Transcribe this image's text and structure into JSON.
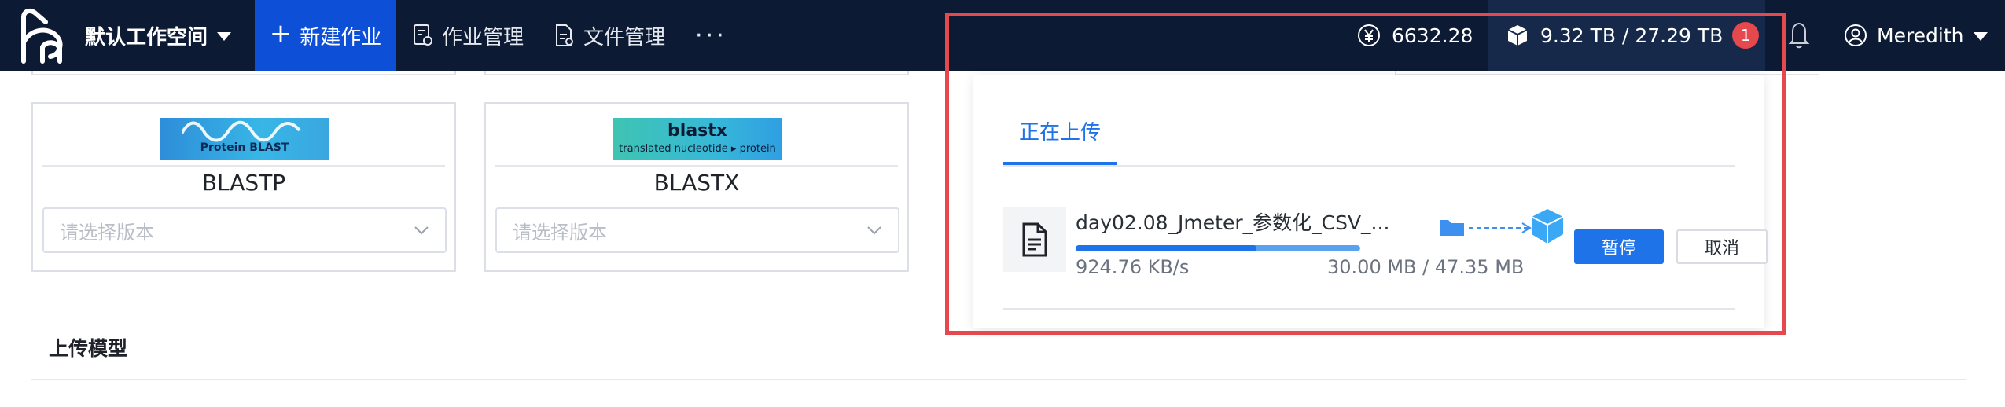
{
  "header": {
    "workspace": "默认工作空间",
    "new_job": "新建作业",
    "nav": [
      {
        "label": "作业管理",
        "icon": "job-management-icon"
      },
      {
        "label": "文件管理",
        "icon": "file-management-icon"
      }
    ],
    "more": "···",
    "balance": "6632.28",
    "balance_icon": "yen-icon",
    "storage": "9.32 TB / 27.29 TB",
    "storage_icon": "cube-icon",
    "notification_badge": "1",
    "user": "Meredith"
  },
  "tools": [
    {
      "name": "BLASTP",
      "banner_title": "Protein BLAST",
      "banner_sub": "",
      "select_placeholder": "请选择版本"
    },
    {
      "name": "BLASTX",
      "banner_title": "blastx",
      "banner_sub": "translated nucleotide ▸ protein",
      "select_placeholder": "请选择版本"
    }
  ],
  "section": {
    "title": "上传模型"
  },
  "upload_panel": {
    "tab": "正在上传",
    "file": {
      "name": "day02.08_Jmeter_参数化_CSV_...",
      "speed": "924.76 KB/s",
      "size": "30.00 MB / 47.35 MB",
      "progress": 0.634,
      "buffered": 0.43
    },
    "pause_label": "暂停",
    "cancel_label": "取消"
  },
  "colors": {
    "nav_bg": "#0c1a33",
    "nav_active": "#0e4fd8",
    "primary": "#1e73e8",
    "badge": "#e5484d",
    "highlight": "#e5484d"
  }
}
